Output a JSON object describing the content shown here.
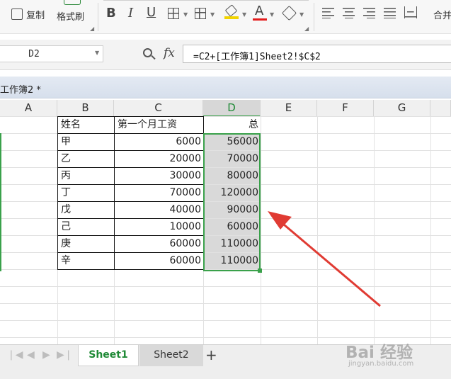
{
  "toolbar": {
    "copy_label": "复制",
    "format_painter_label": "格式刷",
    "bold": "B",
    "italic": "I",
    "underline": "U",
    "font_color_glyph": "A",
    "merge_label": "合并"
  },
  "formula_bar": {
    "cell_reference": "D2",
    "fx_label": "fx",
    "formula": "=C2+[工作簿1]Sheet2!$C$2"
  },
  "document": {
    "title": "工作簿2 *"
  },
  "grid": {
    "columns": [
      "A",
      "B",
      "C",
      "D",
      "E",
      "F",
      "G"
    ],
    "header_row": {
      "name": "姓名",
      "salary": "第一个月工资",
      "total": "总"
    },
    "rows": [
      {
        "name": "甲",
        "salary": "6000",
        "total": "56000"
      },
      {
        "name": "乙",
        "salary": "20000",
        "total": "70000"
      },
      {
        "name": "丙",
        "salary": "30000",
        "total": "80000"
      },
      {
        "name": "丁",
        "salary": "70000",
        "total": "120000"
      },
      {
        "name": "戊",
        "salary": "40000",
        "total": "90000"
      },
      {
        "name": "己",
        "salary": "10000",
        "total": "60000"
      },
      {
        "name": "庚",
        "salary": "60000",
        "total": "110000"
      },
      {
        "name": "辛",
        "salary": "60000",
        "total": "110000"
      }
    ]
  },
  "sheets": {
    "tabs": [
      "Sheet1",
      "Sheet2"
    ],
    "active": "Sheet1",
    "add_glyph": "+"
  },
  "watermark": {
    "text": "Bai 经验",
    "sub": "jingyan.baidu.com"
  },
  "colors": {
    "selection_green": "#3aa14b",
    "arrow_red": "#e03b33",
    "selected_fill": "#d9d9d9"
  }
}
